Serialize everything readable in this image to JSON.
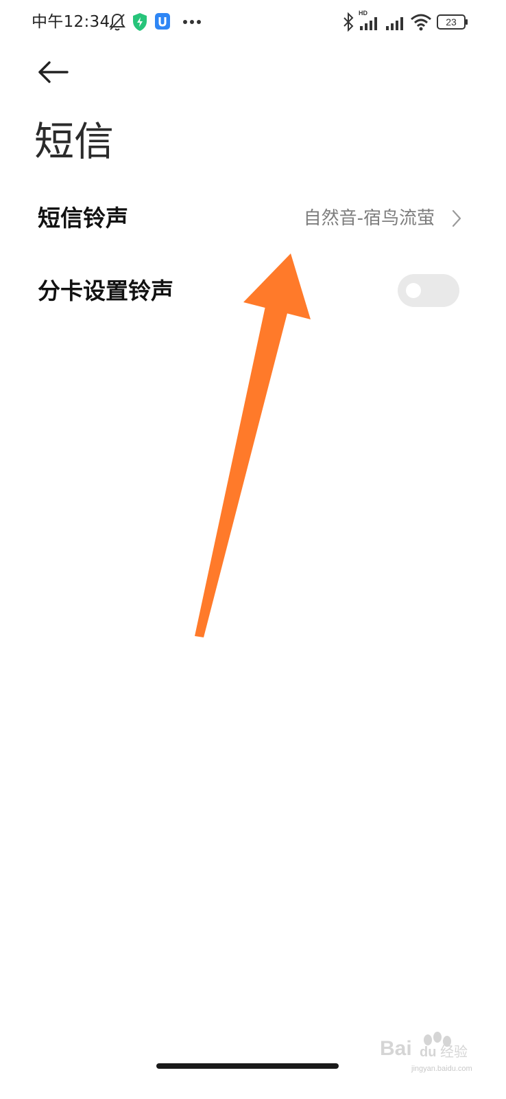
{
  "status_bar": {
    "time": "中午12:34",
    "battery": "23",
    "network_badge": "HD",
    "icons": [
      "notifications-muted-icon",
      "security-shield-icon",
      "app-notification-icon",
      "more-dots-icon",
      "bluetooth-icon",
      "signal-hd-icon",
      "signal-icon",
      "wifi-icon",
      "battery-icon"
    ],
    "colors": {
      "shield": "#27c47a",
      "app_badge": "#2e86f5"
    }
  },
  "header": {
    "back_icon": "back-arrow-icon",
    "title": "短信"
  },
  "settings": {
    "sms_ringtone": {
      "label": "短信铃声",
      "value": "自然音-宿鸟流萤",
      "icon": "chevron-right-icon"
    },
    "per_sim_ringtone": {
      "label": "分卡设置铃声",
      "toggle_state": "off"
    }
  },
  "annotation": {
    "type": "arrow",
    "color": "#ff7a2a",
    "points_to": "sms-ringtone-value"
  },
  "watermark": {
    "brand": "Baidu经验",
    "site": "jingyan.baidu.com"
  }
}
